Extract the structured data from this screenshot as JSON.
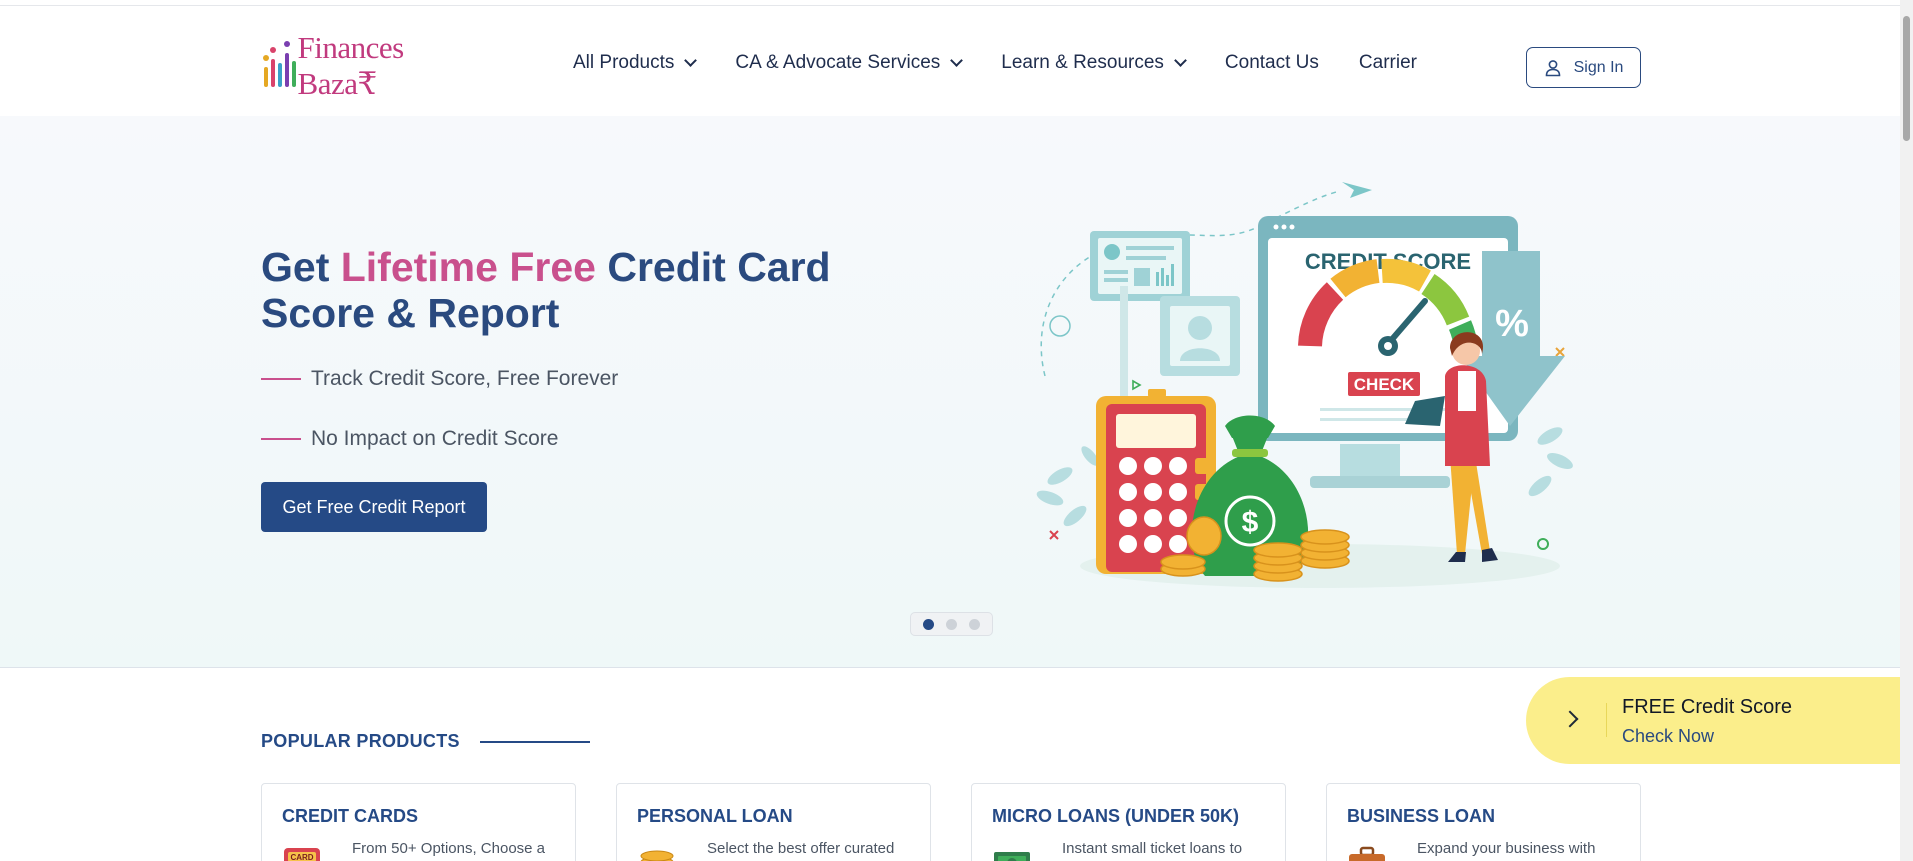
{
  "brand": {
    "name": "Finances Baza₹"
  },
  "nav": {
    "items": [
      {
        "label": "All Products",
        "has_dropdown": true
      },
      {
        "label": "CA & Advocate Services",
        "has_dropdown": true
      },
      {
        "label": "Learn & Resources",
        "has_dropdown": true
      },
      {
        "label": "Contact Us",
        "has_dropdown": false
      },
      {
        "label": "Carrier",
        "has_dropdown": false
      }
    ],
    "signin_label": "Sign In"
  },
  "hero": {
    "title_part1": "Get ",
    "title_highlight": "Lifetime Free",
    "title_part2": " Credit Card Score & Report",
    "bullets": [
      "Track Credit Score, Free Forever",
      "No Impact on Credit Score"
    ],
    "cta_label": "Get Free Credit Report",
    "slides_count": 3,
    "active_slide": 1,
    "illustration": {
      "screen_title": "CREDIT SCORE",
      "check_label": "CHECK",
      "percent_symbol": "%",
      "dollar_symbol": "$",
      "card_label": "CARD"
    }
  },
  "popular": {
    "title": "POPULAR PRODUCTS",
    "cards": [
      {
        "title": "CREDIT CARDS",
        "desc": "From 50+ Options, Choose a",
        "icon": "credit-card-icon"
      },
      {
        "title": "PERSONAL LOAN",
        "desc": "Select the best offer curated",
        "icon": "coins-icon"
      },
      {
        "title": "MICRO LOANS (UNDER 50K)",
        "desc": "Instant small ticket loans to",
        "icon": "cash-icon"
      },
      {
        "title": "BUSINESS LOAN",
        "desc": "Expand your business with",
        "icon": "briefcase-icon"
      }
    ]
  },
  "floating_banner": {
    "title": "FREE Credit Score",
    "link": "Check Now"
  },
  "colors": {
    "primary": "#254a86",
    "accent": "#c9508d",
    "banner": "#fbee8b"
  }
}
